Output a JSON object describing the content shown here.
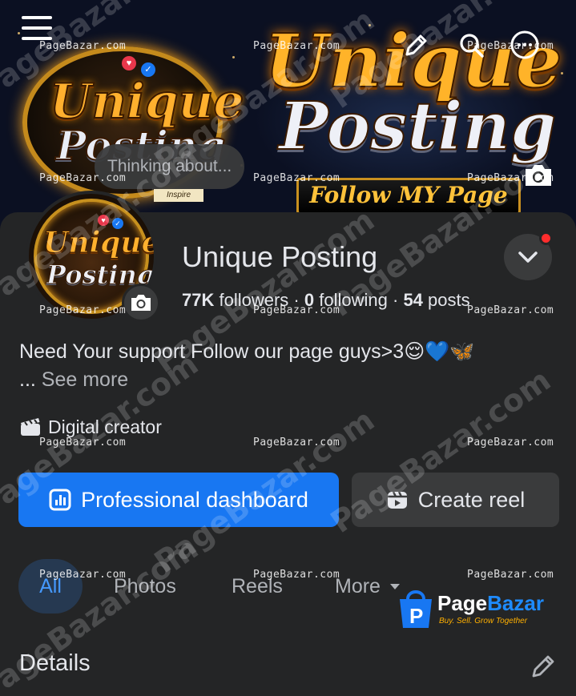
{
  "cover": {
    "art_word_1": "Unique",
    "art_word_2": "Posting",
    "ribbon_text": "Follow MY Page",
    "small_tag": "Inspire"
  },
  "composer": {
    "prompt": "Thinking about..."
  },
  "profile": {
    "name": "Unique Posting",
    "followers_count": "77K",
    "followers_label": "followers",
    "following_count": "0",
    "following_label": "following",
    "posts_count": "54",
    "posts_label": "posts",
    "separator": "·",
    "bio": "Need Your support Follow our page guys>3😌💙🦋",
    "bio_ellipsis": "...",
    "see_more_label": "See more",
    "category": "Digital creator"
  },
  "actions": {
    "primary_label": "Professional dashboard",
    "secondary_label": "Create reel"
  },
  "tabs": [
    {
      "label": "All"
    },
    {
      "label": "Photos"
    },
    {
      "label": "Reels"
    },
    {
      "label": "More"
    }
  ],
  "details": {
    "title": "Details"
  },
  "watermark": {
    "text": "PageBazar.com",
    "brand_part1": "Page",
    "brand_part2": "Bazar",
    "tagline": "Buy. Sell. Grow Together"
  },
  "colors": {
    "background": "#242526",
    "primary_button": "#1877f2",
    "secondary_button": "#3a3b3c",
    "active_tab_text": "#4599ff",
    "notification_dot": "#ff2d2d"
  },
  "icons": {
    "menu": "hamburger-menu-icon",
    "edit": "pencil-icon",
    "search": "search-icon",
    "more": "more-icon",
    "camera": "camera-icon",
    "dropdown": "chevron-down-icon",
    "category": "clapperboard-icon",
    "dashboard": "dashboard-icon",
    "reel": "reel-icon"
  }
}
